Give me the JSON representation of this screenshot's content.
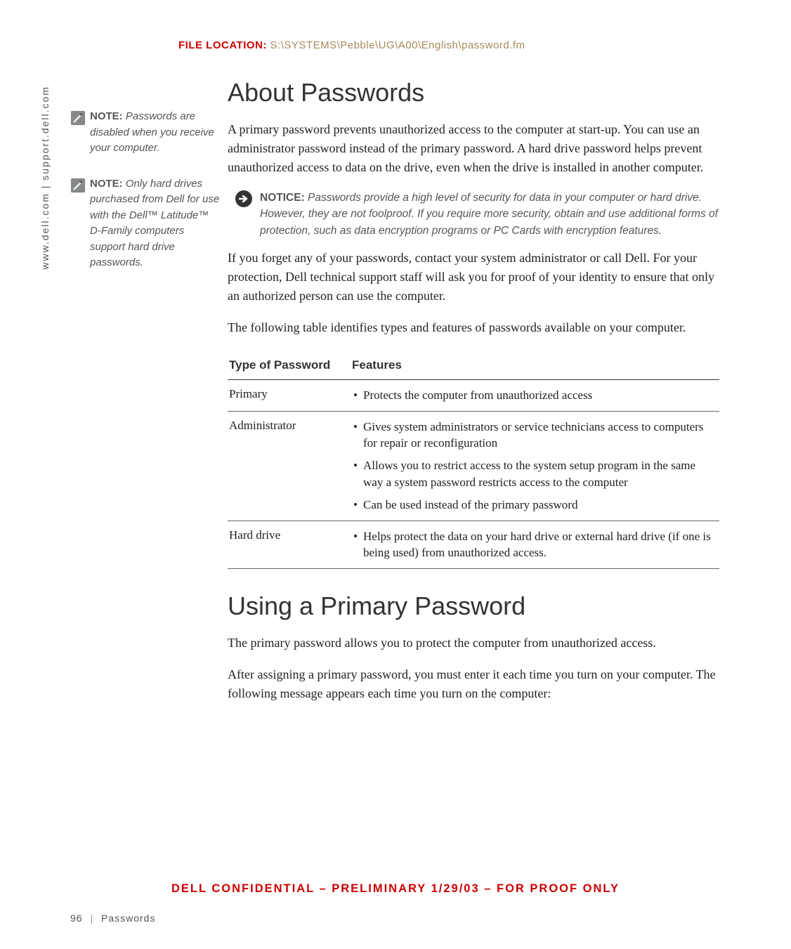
{
  "header": {
    "label": "FILE LOCATION:",
    "path": "S:\\SYSTEMS\\Pebble\\UG\\A00\\English\\password.fm"
  },
  "vertical": "www.dell.com | support.dell.com",
  "notes": [
    {
      "label": "NOTE:",
      "text": "Passwords are disabled when you receive your computer."
    },
    {
      "label": "NOTE:",
      "text": "Only hard drives purchased from Dell for use with the Dell™ Latitude™ D-Family computers support hard drive passwords."
    }
  ],
  "section1": {
    "title": "About Passwords",
    "p1": "A primary password prevents unauthorized access to the computer at start-up. You can use an administrator password instead of the primary password. A hard drive password helps prevent unauthorized access to data on the drive, even when the drive is installed in another computer.",
    "notice": {
      "label": "NOTICE:",
      "text": "Passwords provide a high level of security for data in your computer or hard drive. However, they are not foolproof. If you require more security, obtain and use additional forms of protection, such as data encryption programs or PC Cards with encryption features."
    },
    "p2": "If you forget any of your passwords, contact your system administrator or call Dell. For your protection, Dell technical support staff will ask you for proof of your identity to ensure that only an authorized person can use the computer.",
    "p3": "The following table identifies types and features of passwords available on your computer."
  },
  "table": {
    "headers": [
      "Type of Password",
      "Features"
    ],
    "rows": [
      {
        "type": "Primary",
        "features": [
          "Protects the computer from unauthorized access"
        ]
      },
      {
        "type": "Administrator",
        "features": [
          "Gives system administrators or service technicians access to computers for repair or reconfiguration",
          "Allows you to restrict access to the system setup program in the same way a system password restricts access to the computer",
          "Can be used instead of the primary password"
        ]
      },
      {
        "type": "Hard drive",
        "features": [
          "Helps protect the data on your hard drive or external hard drive (if one is being used) from unauthorized access."
        ]
      }
    ]
  },
  "section2": {
    "title": "Using a Primary Password",
    "p1": "The primary password allows you to protect the computer from unauthorized access.",
    "p2": "After assigning a primary password, you must enter it each time you turn on your computer. The following message appears each time you turn on the computer:"
  },
  "confidential": "DELL CONFIDENTIAL – PRELIMINARY 1/29/03 – FOR PROOF ONLY",
  "footer": {
    "page": "96",
    "section": "Passwords"
  }
}
